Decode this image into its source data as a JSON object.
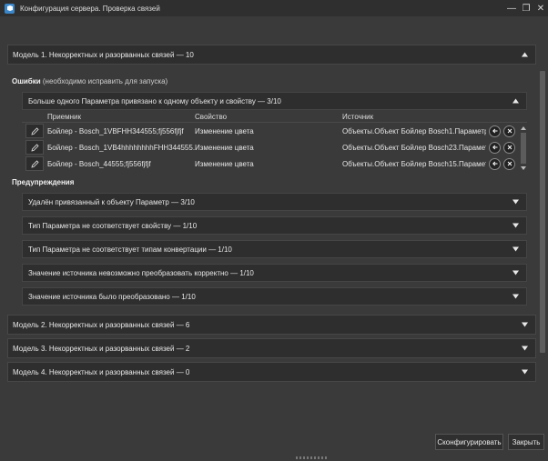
{
  "window": {
    "title": "Конфигурация сервера. Проверка связей",
    "minimize": "—",
    "maximize": "❐",
    "close": "✕"
  },
  "models": [
    {
      "label": "Модель 1. Некорректных и разорванных связей — 10",
      "expanded": true
    },
    {
      "label": "Модель 2. Некорректных и разорванных связей — 6",
      "expanded": false
    },
    {
      "label": "Модель 3. Некорректных и разорванных связей — 2",
      "expanded": false
    },
    {
      "label": "Модель 4. Некорректных и разорванных связей — 0",
      "expanded": false
    }
  ],
  "errors": {
    "title_bold": "Ошибки",
    "title_rest": " (необходимо исправить для запуска)",
    "group_label": "Больше одного Параметра привязано к одному объекту и свойству — 3/10",
    "columns": [
      "Приемник",
      "Свойство",
      "Источник"
    ],
    "rows": [
      {
        "receiver": "Бойлер - Bosch_1VBFHH344555;fj556fjfjf",
        "property": "Изменение цвета",
        "source": "Объекты.Объект Бойлер Bosch1.Параметр..."
      },
      {
        "receiver": "Бойлер - Bosch_1VB4hhhhhhhhFHH344555...",
        "property": "Изменение цвета",
        "source": "Объекты.Объект Бойлер Bosch23.Парамет..."
      },
      {
        "receiver": "Бойлер - Bosch_44555;fj556fjfjf",
        "property": "Изменение цвета",
        "source": "Объекты.Объект Бойлер Bosch15.Парамет..."
      }
    ]
  },
  "warnings": {
    "title": "Предупреждения",
    "items": [
      "Удалён привязанный к объекту Параметр — 3/10",
      "Тип Параметра не соответствует свойству — 1/10",
      "Тип Параметра не соответствует типам конвертации — 1/10",
      "Значение источника невозможно преобразовать корректно — 1/10",
      "Значение источника было преобразовано — 1/10"
    ]
  },
  "footer": {
    "configure": "Сконфигурировать",
    "close": "Закрыть"
  },
  "colors": {
    "background": "#3a3a3a",
    "bar": "#2e2e2e",
    "accent": "#3a86c8"
  }
}
